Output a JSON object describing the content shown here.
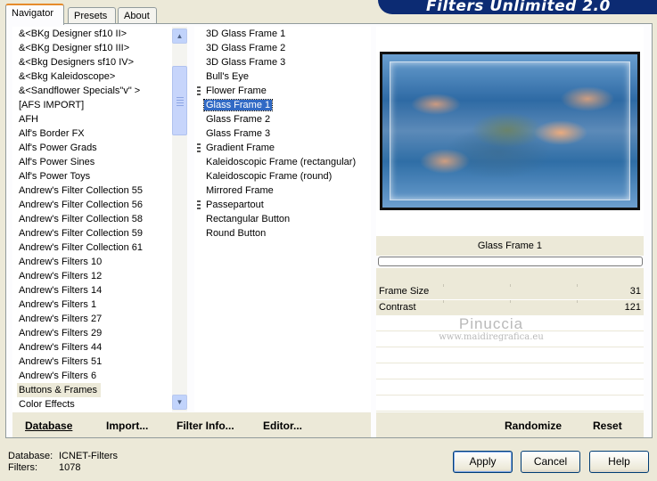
{
  "tabs": [
    {
      "label": "Navigator",
      "active": true
    },
    {
      "label": "Presets",
      "active": false
    },
    {
      "label": "About",
      "active": false
    }
  ],
  "banner": "Filters Unlimited 2.0",
  "categories": [
    "&<BKg Designer sf10 II>",
    "&<BKg Designer sf10 III>",
    "&<Bkg Designers sf10 IV>",
    "&<Bkg Kaleidoscope>",
    "&<Sandflower Specials\"v\" >",
    "[AFS IMPORT]",
    "AFH",
    "Alf's Border FX",
    "Alf's Power Grads",
    "Alf's Power Sines",
    "Alf's Power Toys",
    "Andrew's Filter Collection 55",
    "Andrew's Filter Collection 56",
    "Andrew's Filter Collection 58",
    "Andrew's Filter Collection 59",
    "Andrew's Filter Collection 61",
    "Andrew's Filters 10",
    "Andrew's Filters 12",
    "Andrew's Filters 14",
    "Andrew's Filters 1",
    "Andrew's Filters 27",
    "Andrew's Filters 29",
    "Andrew's Filters 44",
    "Andrew's Filters 51",
    "Andrew's Filters 6",
    "Buttons & Frames",
    "Color Effects"
  ],
  "selected_category": "Buttons & Frames",
  "filters": [
    {
      "label": "3D Glass Frame 1",
      "marker": false
    },
    {
      "label": "3D Glass Frame 2",
      "marker": false
    },
    {
      "label": "3D Glass Frame 3",
      "marker": false
    },
    {
      "label": "Bull's Eye",
      "marker": false
    },
    {
      "label": "Flower Frame",
      "marker": true
    },
    {
      "label": "Glass Frame 1",
      "marker": false,
      "selected": true
    },
    {
      "label": "Glass Frame 2",
      "marker": false
    },
    {
      "label": "Glass Frame 3",
      "marker": false
    },
    {
      "label": "Gradient Frame",
      "marker": true
    },
    {
      "label": "Kaleidoscopic Frame (rectangular)",
      "marker": false
    },
    {
      "label": "Kaleidoscopic Frame (round)",
      "marker": false
    },
    {
      "label": "Mirrored Frame",
      "marker": false
    },
    {
      "label": "Passepartout",
      "marker": true
    },
    {
      "label": "Rectangular Button",
      "marker": false
    },
    {
      "label": "Round Button",
      "marker": false
    }
  ],
  "left_actions": {
    "database": "Database",
    "import": "Import...",
    "filter_info": "Filter Info...",
    "editor": "Editor..."
  },
  "right_actions": {
    "randomize": "Randomize",
    "reset": "Reset"
  },
  "current_filter": "Glass Frame 1",
  "params": [
    {
      "name": "Frame Size",
      "value": "31"
    },
    {
      "name": "Contrast",
      "value": "121"
    }
  ],
  "watermark": {
    "title": "Pinuccia",
    "url": "www.maidiregrafica.eu"
  },
  "status": {
    "database_label": "Database:",
    "database_value": "ICNET-Filters",
    "filters_label": "Filters:",
    "filters_value": "1078"
  },
  "buttons": {
    "apply": "Apply",
    "cancel": "Cancel",
    "help": "Help"
  },
  "colors": {
    "accent": "#316ac5",
    "banner": "#0c2b73",
    "dialog_bg": "#ece9d8"
  }
}
